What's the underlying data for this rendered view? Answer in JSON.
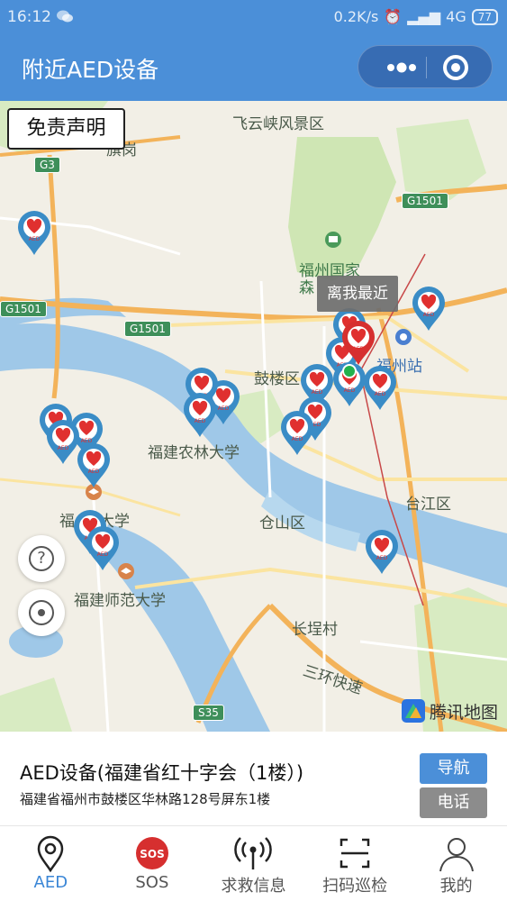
{
  "status": {
    "time": "16:12",
    "network_speed": "0.2K/s",
    "network_type": "4G",
    "battery": "77"
  },
  "header": {
    "title": "附近AED设备"
  },
  "map": {
    "disclaimer": "免责声明",
    "nearest_label": "离我最近",
    "attribution": "腾讯地图",
    "place_labels": {
      "feiyunxia": "飞云峡风景区",
      "fuzhou_forest_1": "福州国家",
      "fuzhou_forest_2": "森",
      "gulou": "鼓楼区",
      "fuzhou_station": "福州站",
      "fafu": "福建农林大学",
      "taijiang": "台江区",
      "cangshan": "仓山区",
      "fu_univ_1": "福",
      "fu_univ_2": "大学",
      "fjnu": "福建师范大学",
      "changti": "长埕村",
      "ring_road": "三环快速",
      "qigang": "旗岗"
    },
    "road_shields": {
      "g3": "G3",
      "g1501_left": "G1501",
      "g1501_mid": "G1501",
      "g1501_right": "G1501",
      "s35": "S35"
    }
  },
  "device": {
    "name": "AED设备(福建省红十字会（1楼）)",
    "address": "福建省福州市鼓楼区华林路128号屏东1楼",
    "navigate_label": "导航",
    "call_label": "电话"
  },
  "tabs": [
    {
      "label": "AED",
      "icon": "location-pin-icon"
    },
    {
      "label": "SOS",
      "icon": "sos-icon"
    },
    {
      "label": "求救信息",
      "icon": "signal-tower-icon"
    },
    {
      "label": "扫码巡检",
      "icon": "scan-icon"
    },
    {
      "label": "我的",
      "icon": "user-icon"
    }
  ],
  "colors": {
    "primary": "#4b8fd8",
    "active_tab": "#3a86d6",
    "marker_blue": "#3a8cc6",
    "marker_red": "#d62f2f",
    "water": "#9fc8e8",
    "park": "#cfe6b4"
  }
}
